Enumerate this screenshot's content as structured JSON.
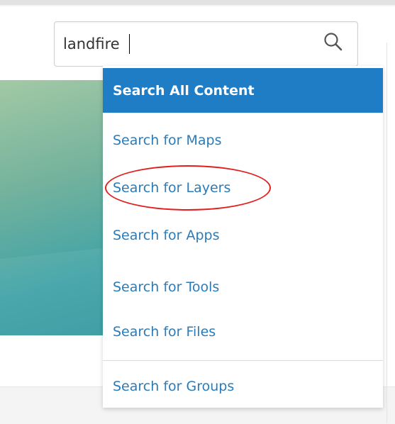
{
  "search": {
    "value": "landfire"
  },
  "icons": {
    "search": "search-icon"
  },
  "colors": {
    "accent": "#1f7dc6",
    "link": "#2a7bb8",
    "highlight_ring": "#e0201f"
  },
  "dropdown": {
    "items": [
      {
        "label": "Search All Content",
        "active": true
      },
      {
        "label": "Search for Maps"
      },
      {
        "label": "Search for Layers",
        "highlighted": true
      },
      {
        "label": "Search for Apps"
      },
      {
        "label": "Search for Tools"
      },
      {
        "label": "Search for Files"
      },
      {
        "label": "Search for Groups"
      }
    ]
  }
}
